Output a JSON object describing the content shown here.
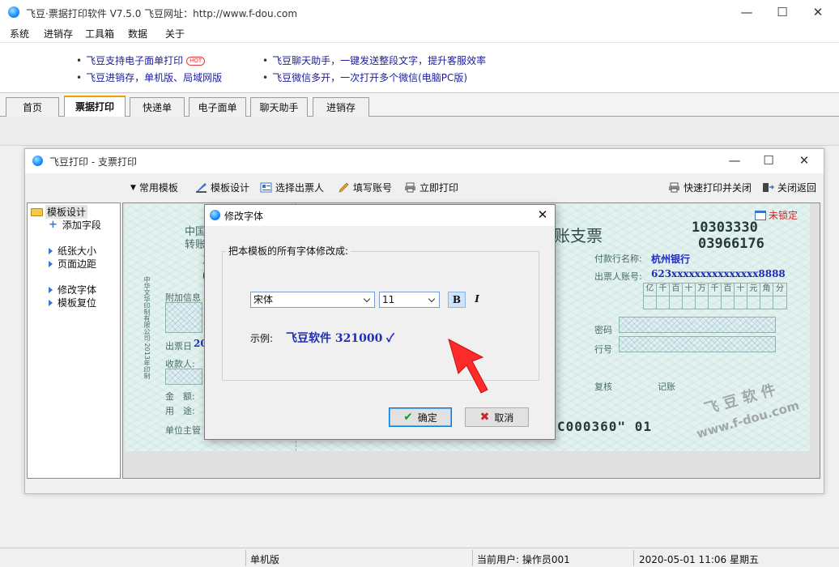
{
  "window": {
    "title": "飞豆·票据打印软件 V7.5.0   飞豆网址：http://www.f-dou.com",
    "minimize": "—",
    "maximize": "☐",
    "close": "✕"
  },
  "menu": [
    "系统",
    "进销存",
    "工具箱",
    "数据",
    "关于"
  ],
  "ads": {
    "left_1": "飞豆支持电子面单打印",
    "hot": "HOT",
    "left_2": "飞豆进销存，单机版、局域网版",
    "right_1": "飞豆聊天助手，一键发送整段文字，提升客服效率",
    "right_2": "飞豆微信多开，一次打开多个微信(电脑PC版)"
  },
  "tabs": [
    "首页",
    "票据打印",
    "快递单",
    "电子面单",
    "聊天助手",
    "进销存"
  ],
  "inner": {
    "title": "飞豆打印 - 支票打印",
    "toolbar": {
      "common_templates": "常用模板",
      "template_design": "模板设计",
      "select_drawer": "选择出票人",
      "fill_account": "填写账号",
      "print_now": "立即打印",
      "quick_print_close": "快速打印并关闭",
      "close_return": "关闭返回"
    },
    "tree": {
      "root": "模板设计",
      "items": [
        "添加字段",
        "纸张大小",
        "页面边距",
        "修改字体",
        "模板复位"
      ]
    }
  },
  "cheque": {
    "bank_frag_1": "中国",
    "bank_frag_2": "转账",
    "num_frag_1": "103",
    "num_frag_2": "039",
    "title_frag": "账支票",
    "code_1": "10303330",
    "code_2": "03966176",
    "payee_label": "付款行名称:",
    "payee_bank": "杭州银行",
    "account_label": "出票人账号:",
    "account_no": "623xxxxxxxxxxxxxxx8888",
    "digits": [
      "亿",
      "千",
      "百",
      "十",
      "万",
      "千",
      "百",
      "十",
      "元",
      "角",
      "分"
    ],
    "password_label": "密码",
    "row_label": "行号",
    "review": "复核",
    "bookkeep": "记账",
    "micr": "C000360\" 01",
    "stub_extra": "附加信息",
    "stub_date": "出票日",
    "stub_date_val": "20",
    "stub_payee": "收款人:",
    "stub_amount": "金　额:",
    "stub_use": "用　途:",
    "stub_supervisor": "单位主管",
    "stub_vertical": "中华文华印制有限公司·2013年印制",
    "unlocked": "未锁定",
    "wm_1": "飞 豆 软 件",
    "wm_2": "www.f-dou.com"
  },
  "dialog": {
    "title": "修改字体",
    "close": "✕",
    "group_label": "把本模板的所有字体修改成:",
    "font_name": "宋体",
    "font_size": "11",
    "bold": "B",
    "italic": "I",
    "sample_label": "示例:",
    "sample_text": "飞豆软件   321000   ✓",
    "ok": "确定",
    "cancel": "取消"
  },
  "status": {
    "mode": "单机版",
    "user": "当前用户: 操作员001",
    "datetime": "2020-05-01 11:06 星期五"
  },
  "colors": {
    "accent_blue": "#1d2dbf",
    "link_blue": "#1d1d9a",
    "unlocked_red": "#d32020",
    "arrow_red": "#ff2a2a"
  }
}
